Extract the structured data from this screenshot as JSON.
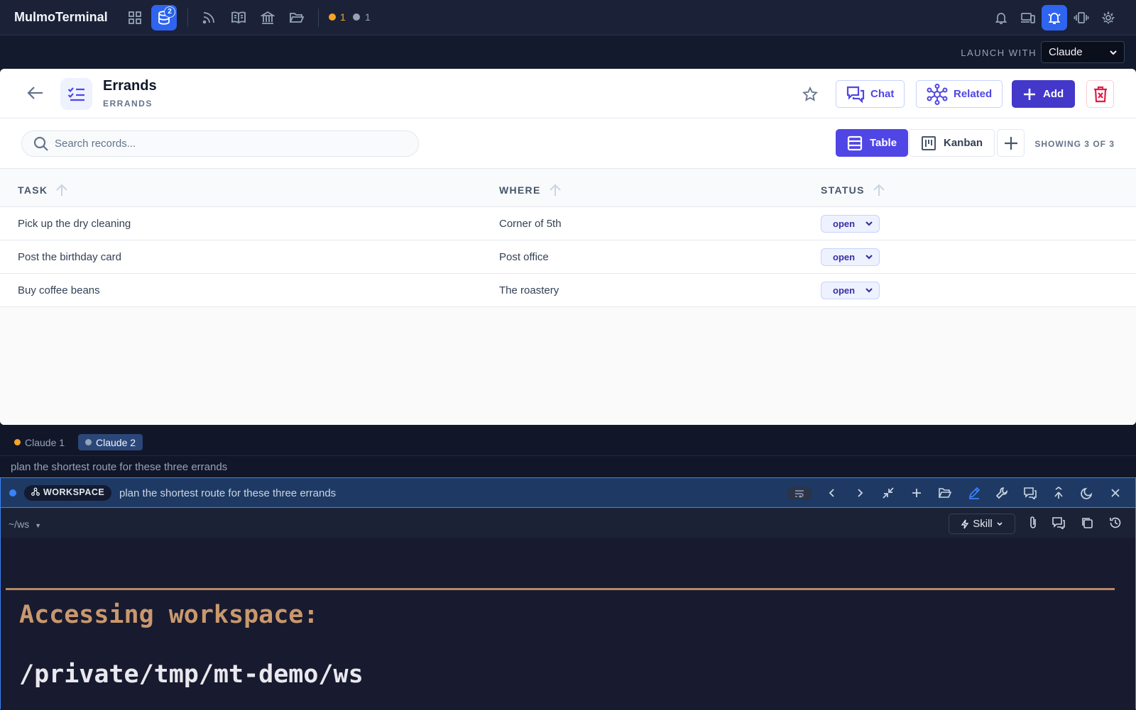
{
  "app": {
    "title": "MulmoTerminal",
    "db_badge": "2"
  },
  "topbar": {
    "status": [
      {
        "color": "#f5a524",
        "count": "1"
      },
      {
        "color": "#94a3b8",
        "count": "1"
      }
    ],
    "accent": "#2f64f0"
  },
  "launch": {
    "label": "LAUNCH WITH",
    "selected": "Claude"
  },
  "collection": {
    "title": "Errands",
    "subtitle": "ERRANDS",
    "buttons": {
      "chat": "Chat",
      "related": "Related",
      "add": "Add"
    }
  },
  "toolbar": {
    "search_placeholder": "Search records...",
    "view_table": "Table",
    "view_kanban": "Kanban",
    "showing": "SHOWING 3 OF 3"
  },
  "table": {
    "columns": [
      "TASK",
      "WHERE",
      "STATUS"
    ],
    "rows": [
      {
        "task": "Pick up the dry cleaning",
        "where": "Corner of 5th",
        "status": "open"
      },
      {
        "task": "Post the birthday card",
        "where": "Post office",
        "status": "open"
      },
      {
        "task": "Buy coffee beans",
        "where": "The roastery",
        "status": "open"
      }
    ]
  },
  "sessions": {
    "tabs": [
      {
        "label": "Claude 1",
        "dot": "#f5a524"
      },
      {
        "label": "Claude 2",
        "dot": "#94a3b8"
      }
    ],
    "prompt": "plan the shortest route for these three errands"
  },
  "terminal": {
    "badge": "WORKSPACE",
    "title": "plan the shortest route for these three errands",
    "cwd": "~/ws",
    "skill": "Skill",
    "line1": "Accessing workspace:",
    "line2": "/private/tmp/mt-demo/ws"
  }
}
